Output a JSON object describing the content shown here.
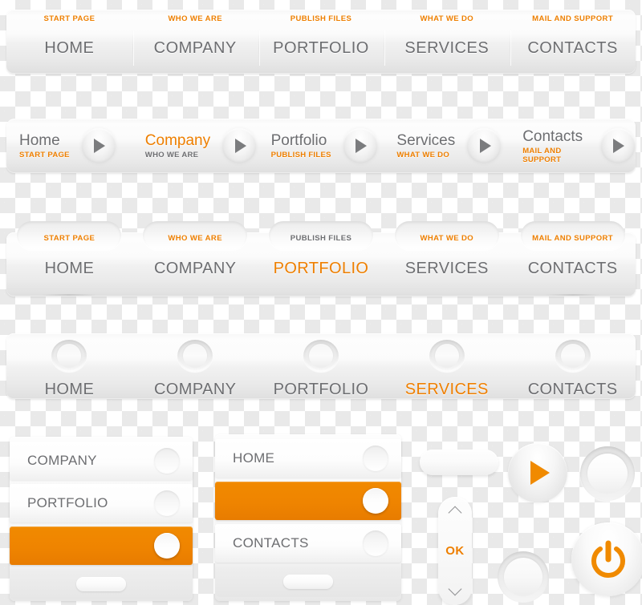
{
  "palette": {
    "accent_orange": "#ee7f00",
    "bar_orange": "#f08a00",
    "text_grey": "#6d6e71",
    "panel_white": "#ffffff"
  },
  "bar1": {
    "items": [
      {
        "sub": "START PAGE",
        "main": "HOME",
        "active": false
      },
      {
        "sub": "WHO WE ARE",
        "main": "COMPANY",
        "active": false
      },
      {
        "sub": "PUBLISH FILES",
        "main": "PORTFOLIO",
        "active": false
      },
      {
        "sub": "WHAT WE DO",
        "main": "SERVICES",
        "active": false
      },
      {
        "sub": "MAIL AND SUPPORT",
        "main": "CONTACTS",
        "active": false
      }
    ]
  },
  "bar2": {
    "items": [
      {
        "main": "Home",
        "sub": "START PAGE",
        "active": false,
        "sub_muted": false
      },
      {
        "main": "Company",
        "sub": "WHO WE ARE",
        "active": true,
        "sub_muted": true
      },
      {
        "main": "Portfolio",
        "sub": "PUBLISH FILES",
        "active": false,
        "sub_muted": false
      },
      {
        "main": "Services",
        "sub": "WHAT WE DO",
        "active": false,
        "sub_muted": false
      },
      {
        "main": "Contacts",
        "sub": "MAIL AND SUPPORT",
        "active": false,
        "sub_muted": false
      }
    ],
    "arrow_icon": "triangle-right-icon"
  },
  "bar3": {
    "items": [
      {
        "sub": "START PAGE",
        "main": "HOME",
        "active": false,
        "sub_muted": false
      },
      {
        "sub": "WHO WE ARE",
        "main": "COMPANY",
        "active": false,
        "sub_muted": false
      },
      {
        "sub": "PUBLISH FILES",
        "main": "PORTFOLIO",
        "active": true,
        "sub_muted": true
      },
      {
        "sub": "WHAT WE DO",
        "main": "SERVICES",
        "active": false,
        "sub_muted": false
      },
      {
        "sub": "MAIL AND SUPPORT",
        "main": "CONTACTS",
        "active": false,
        "sub_muted": false
      }
    ]
  },
  "bar4": {
    "items": [
      {
        "main": "HOME",
        "active": false
      },
      {
        "main": "COMPANY",
        "active": false
      },
      {
        "main": "PORTFOLIO",
        "active": false
      },
      {
        "main": "SERVICES",
        "active": true
      },
      {
        "main": "CONTACTS",
        "active": false
      }
    ],
    "knob_icon": "ring-knob-icon"
  },
  "panel_left": {
    "rows": [
      {
        "label": "COMPANY",
        "on": false
      },
      {
        "label": "PORTFOLIO",
        "on": false
      },
      {
        "label": "",
        "on": true
      }
    ],
    "grip_icon": "grip-pill-icon"
  },
  "panel_mid": {
    "rows": [
      {
        "label": "HOME",
        "on": false
      },
      {
        "label": "",
        "on": true
      },
      {
        "label": "CONTACTS",
        "on": false
      }
    ],
    "grip_icon": "grip-pill-icon"
  },
  "controls": {
    "pill_wide_icon": "blank-pill-icon",
    "ok_label": "OK",
    "ok_up_icon": "chevron-up-icon",
    "ok_down_icon": "chevron-down-icon",
    "play_icon": "play-triangle-icon",
    "ring_top_icon": "ring-button-icon",
    "ring_bottom_icon": "ring-button-icon",
    "power_icon": "power-icon"
  }
}
